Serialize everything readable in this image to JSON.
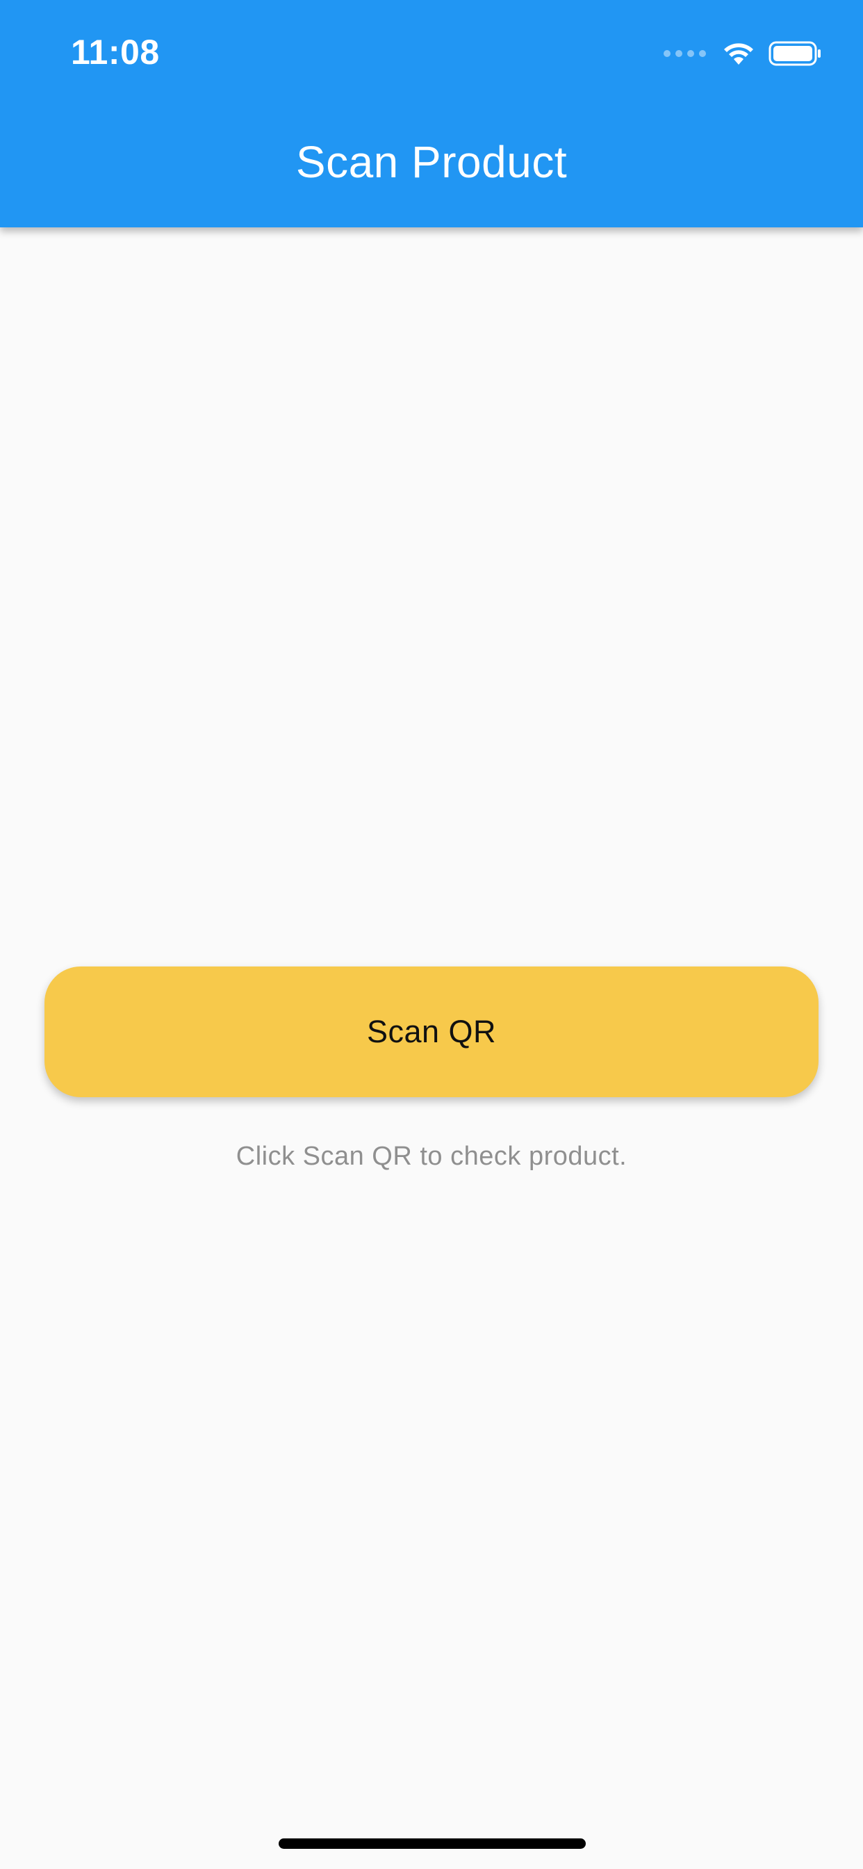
{
  "status_bar": {
    "time": "11:08",
    "signal_icon": "cellular-signal-icon",
    "wifi_icon": "wifi-icon",
    "battery_icon": "battery-icon"
  },
  "app_bar": {
    "title": "Scan Product"
  },
  "main": {
    "scan_button_label": "Scan QR",
    "hint_text": "Click Scan QR to check product."
  },
  "colors": {
    "primary": "#2196f3",
    "accent": "#f7c94b",
    "background": "#fafafa",
    "hint_text": "#8f8f8f"
  }
}
